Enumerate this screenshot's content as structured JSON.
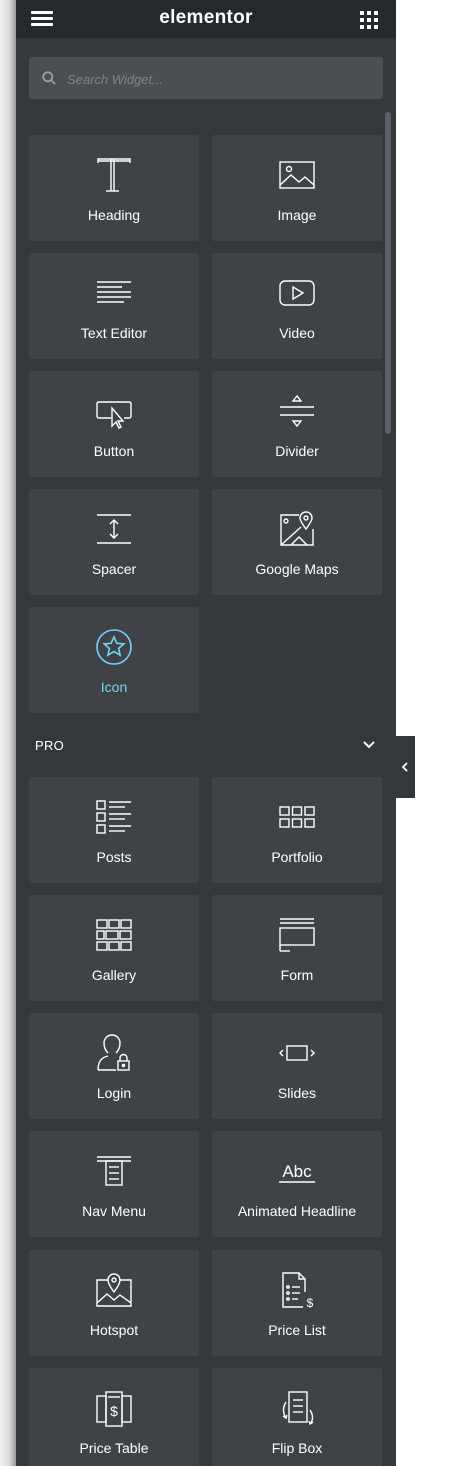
{
  "header": {
    "logo": "elementor",
    "menu_icon": "hamburger-icon",
    "grid_icon": "grid-icon"
  },
  "search": {
    "placeholder": "Search Widget...",
    "value": ""
  },
  "basic_widgets": [
    {
      "label": "Heading",
      "icon": "heading-icon"
    },
    {
      "label": "Image",
      "icon": "image-icon"
    },
    {
      "label": "Text Editor",
      "icon": "text-editor-icon"
    },
    {
      "label": "Video",
      "icon": "video-icon"
    },
    {
      "label": "Button",
      "icon": "button-icon"
    },
    {
      "label": "Divider",
      "icon": "divider-icon"
    },
    {
      "label": "Spacer",
      "icon": "spacer-icon"
    },
    {
      "label": "Google Maps",
      "icon": "google-maps-icon"
    },
    {
      "label": "Icon",
      "icon": "star-icon"
    }
  ],
  "pro_section": {
    "label": "PRO",
    "chevron_icon": "chevron-down-icon"
  },
  "pro_widgets": [
    {
      "label": "Posts",
      "icon": "posts-icon"
    },
    {
      "label": "Portfolio",
      "icon": "portfolio-icon"
    },
    {
      "label": "Gallery",
      "icon": "gallery-icon"
    },
    {
      "label": "Form",
      "icon": "form-icon"
    },
    {
      "label": "Login",
      "icon": "login-icon"
    },
    {
      "label": "Slides",
      "icon": "slides-icon"
    },
    {
      "label": "Nav Menu",
      "icon": "nav-menu-icon"
    },
    {
      "label": "Animated Headline",
      "icon": "animated-headline-icon"
    },
    {
      "label": "Hotspot",
      "icon": "hotspot-icon"
    },
    {
      "label": "Price List",
      "icon": "price-list-icon"
    },
    {
      "label": "Price Table",
      "icon": "price-table-icon"
    },
    {
      "label": "Flip Box",
      "icon": "flip-box-icon"
    }
  ],
  "colors": {
    "panel_bg": "#34383c",
    "header_bg": "#26292c",
    "tile_bg": "#3f4347",
    "accent": "#71d7f7",
    "text": "#ffffff"
  }
}
